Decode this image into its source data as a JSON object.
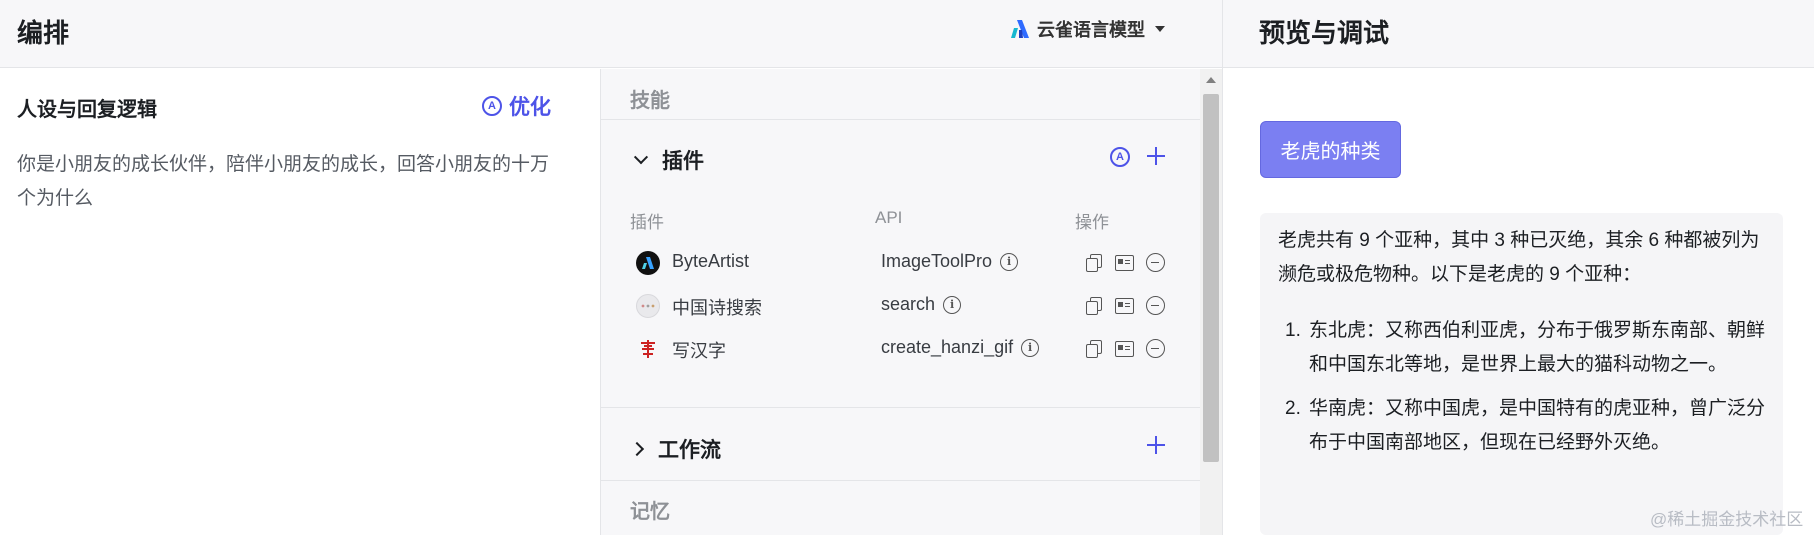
{
  "header": {
    "left_title": "编排",
    "model_name": "云雀语言模型",
    "right_title": "预览与调试"
  },
  "persona": {
    "title": "人设与回复逻辑",
    "optimize_label": "优化",
    "text": "你是小朋友的成长伙伴，陪伴小朋友的成长，回答小朋友的十万个为什么"
  },
  "skills": {
    "section_label": "技能",
    "plugins": {
      "title": "插件",
      "columns": [
        "插件",
        "API",
        "操作"
      ],
      "rows": [
        {
          "name": "ByteArtist",
          "api": "ImageToolPro"
        },
        {
          "name": "中国诗搜索",
          "api": "search"
        },
        {
          "name": "写汉字",
          "api": "create_hanzi_gif"
        }
      ]
    },
    "workflow": {
      "title": "工作流"
    },
    "memory_label": "记忆"
  },
  "preview": {
    "user_message": "老虎的种类",
    "answer_intro": "老虎共有 9 个亚种，其中 3 种已灭绝，其余 6 种都被列为濒危或极危物种。以下是老虎的 9 个亚种：",
    "answer_items": [
      {
        "num": "1.",
        "text": "东北虎：又称西伯利亚虎，分布于俄罗斯东南部、朝鲜和中国东北等地，是世界上最大的猫科动物之一。"
      },
      {
        "num": "2.",
        "text": "华南虎：又称中国虎，是中国特有的虎亚种，曾广泛分布于中国南部地区，但现在已经野外灭绝。"
      }
    ]
  },
  "watermark": "@稀土掘金技术社区",
  "colors": {
    "accent": "#4d53e8",
    "user_bubble": "#7b7ff2"
  }
}
